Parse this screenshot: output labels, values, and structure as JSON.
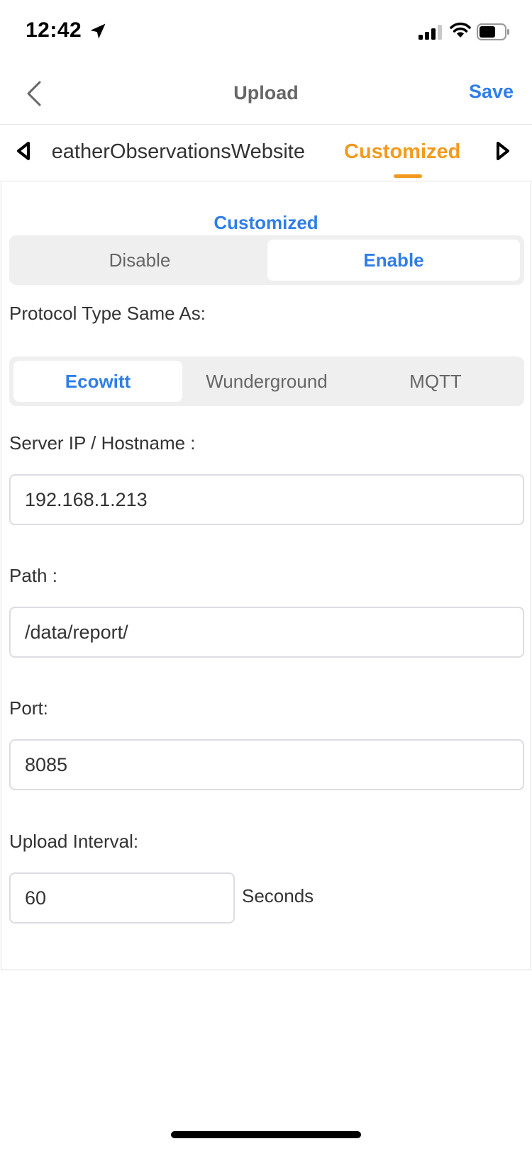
{
  "status_bar": {
    "time": "12:42",
    "icons": [
      "location-arrow-icon",
      "cell-signal-icon",
      "wifi-icon",
      "battery-icon"
    ]
  },
  "nav": {
    "title": "Upload",
    "save_label": "Save",
    "back_icon": "chevron-left-icon"
  },
  "tabs": {
    "items": [
      {
        "label": "WeatherObservationsWebsite",
        "visible_text": "eatherObservationsWebsite",
        "active": false
      },
      {
        "label": "Customized",
        "active": true
      }
    ],
    "active_color": "#f39a1e",
    "prev_icon": "triangle-left-icon",
    "next_icon": "triangle-right-icon"
  },
  "form": {
    "section_title": "Customized",
    "toggle": {
      "options": [
        "Disable",
        "Enable"
      ],
      "selected": "Enable"
    },
    "protocol": {
      "label": "Protocol Type Same As:",
      "options": [
        "Ecowitt",
        "Wunderground",
        "MQTT"
      ],
      "selected": "Ecowitt"
    },
    "server": {
      "label": "Server IP / Hostname :",
      "value": "192.168.1.213"
    },
    "path": {
      "label": "Path :",
      "value": "/data/report/"
    },
    "port": {
      "label": "Port:",
      "value": "8085"
    },
    "interval": {
      "label": "Upload Interval:",
      "value": "60",
      "unit": "Seconds"
    }
  },
  "colors": {
    "accent_blue": "#2f7ee8",
    "accent_orange": "#f39a1e",
    "segment_bg": "#efefef"
  }
}
